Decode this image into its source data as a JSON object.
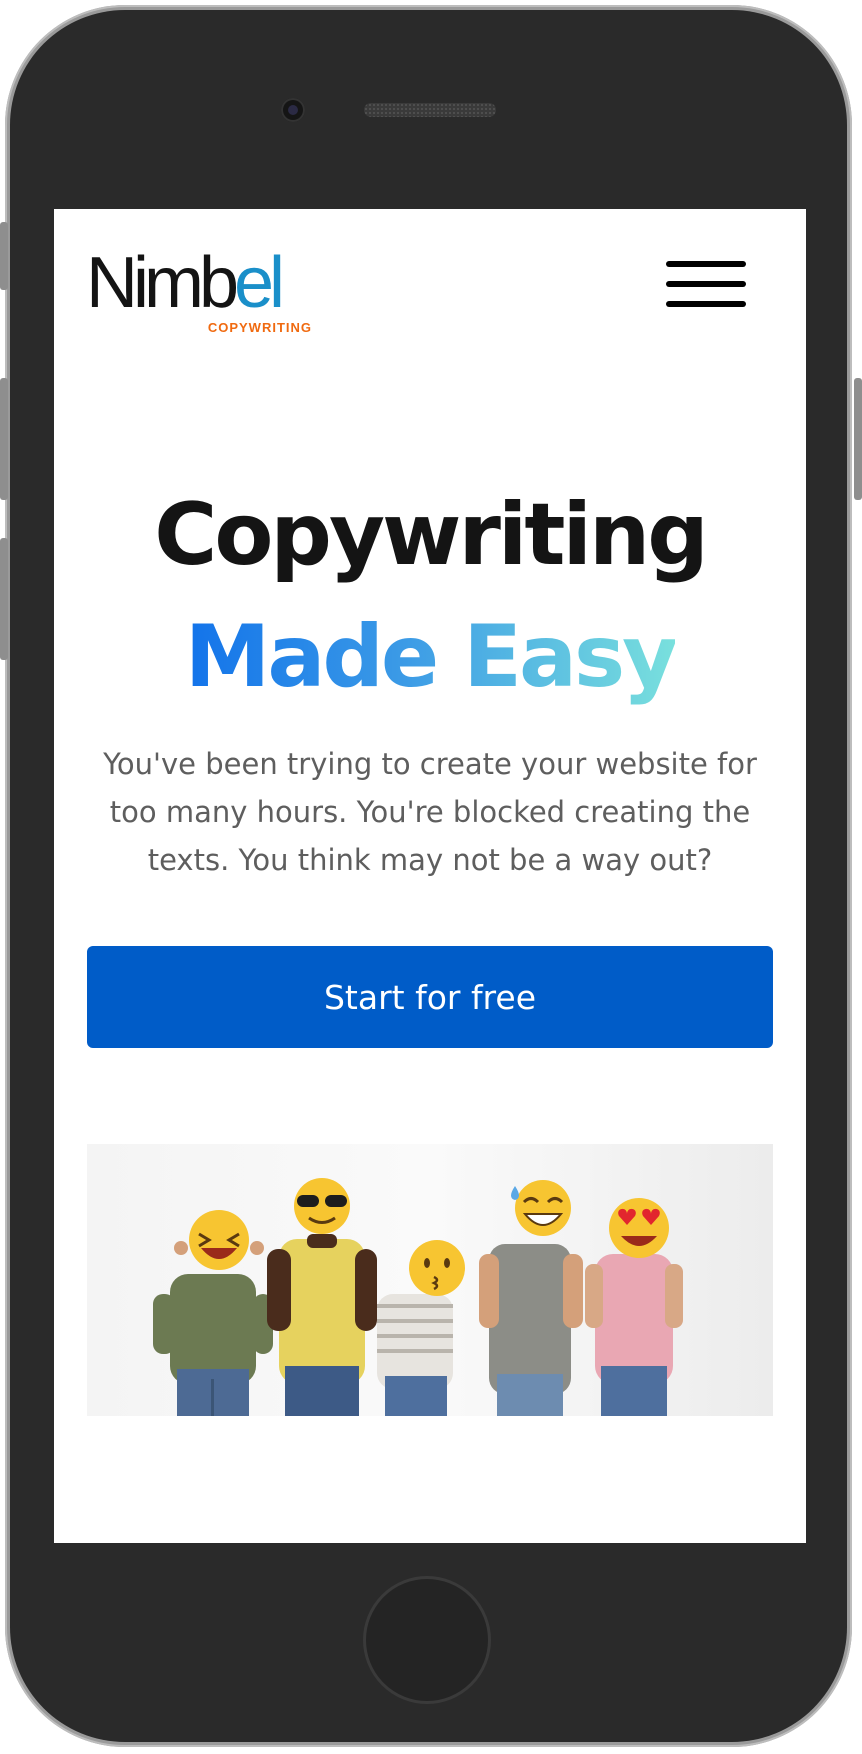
{
  "brand": {
    "name_main": "Nimb",
    "name_accent": "el",
    "tagline": "COPYWRITING"
  },
  "nav": {
    "menu_icon": "hamburger-menu-icon"
  },
  "hero": {
    "title_line1": "Copywriting",
    "title_line2": "Made Easy",
    "subtitle": "You've been trying to create your website for too many hours. You're blocked creating the texts. You think may not be a way out?",
    "cta_label": "Start for free",
    "image_alt": "five people holding emoji masks in front of their faces"
  },
  "colors": {
    "cta_background": "#005cc8",
    "logo_accent": "#1a8fc9",
    "tagline_color": "#f06a10",
    "title_gradient": [
      "#1273ea",
      "#79e0dd"
    ]
  }
}
